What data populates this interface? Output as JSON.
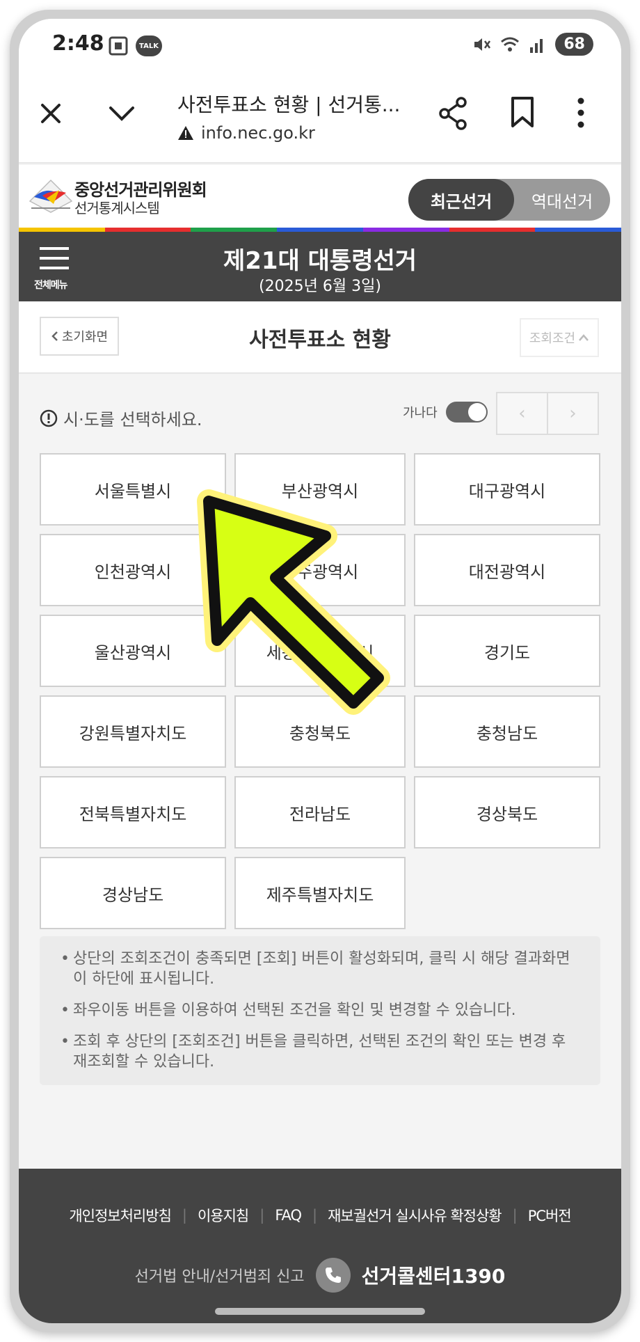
{
  "status_bar": {
    "time": "2:48",
    "talk_badge": "TALK",
    "battery": "68"
  },
  "browser": {
    "page_title": "사전투표소 현황 | 선거통...",
    "url": "info.nec.go.kr"
  },
  "site": {
    "org_name": "중앙선거관리위원회",
    "system_name": "선거통계시스템",
    "toggle_recent": "최근선거",
    "toggle_past": "역대선거",
    "colorbar": [
      "#f5c400",
      "#e62e2e",
      "#1fa04a",
      "#2a5bd7",
      "#8a2be2",
      "#e62e2e",
      "#2a5bd7"
    ]
  },
  "header": {
    "menu_label": "전체메뉴",
    "election_title": "제21대 대통령선거",
    "election_date": "(2025년 6월 3일)"
  },
  "titlebar": {
    "home_button": "초기화면",
    "page_title": "사전투표소 현황",
    "condition_button": "조회조건"
  },
  "content": {
    "notice": "시·도를 선택하세요.",
    "sort_label": "가나다",
    "pager_prev": "‹",
    "pager_next": "›",
    "regions": [
      "서울특별시",
      "부산광역시",
      "대구광역시",
      "인천광역시",
      "광주광역시",
      "대전광역시",
      "울산광역시",
      "세종특별자치시",
      "경기도",
      "강원특별자치도",
      "충청북도",
      "충청남도",
      "전북특별자치도",
      "전라남도",
      "경상북도",
      "경상남도",
      "제주특별자치도"
    ],
    "info_items": [
      "상단의 조회조건이 충족되면 [조회] 버튼이 활성화되며, 클릭 시 해당 결과화면이 하단에 표시됩니다.",
      "좌우이동 버튼을 이용하여 선택된 조건을 확인 및 변경할 수 있습니다.",
      "조회 후 상단의 [조회조건] 버튼을 클릭하면, 선택된 조건의 확인 또는 변경 후 재조회할 수 있습니다."
    ]
  },
  "footer": {
    "links": [
      "개인정보처리방침",
      "이용지침",
      "FAQ",
      "재보궐선거 실시사유 확정상황",
      "PC버전"
    ],
    "report_label": "선거법 안내/선거범죄 신고",
    "call_center": "선거콜센터1390"
  },
  "colors": {
    "dark": "#444444",
    "arrow_fill": "#d7ff14",
    "arrow_glow": "#fff27a"
  }
}
